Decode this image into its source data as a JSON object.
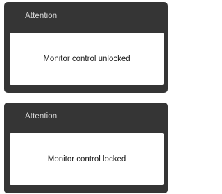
{
  "dialogs": [
    {
      "title": "Attention",
      "message": "Monitor control unlocked"
    },
    {
      "title": "Attention",
      "message": "Monitor control locked"
    }
  ],
  "colors": {
    "dialog_background": "#353535",
    "title_text": "#d8d8d8",
    "message_background": "#ffffff",
    "message_text": "#1a1a1a"
  }
}
